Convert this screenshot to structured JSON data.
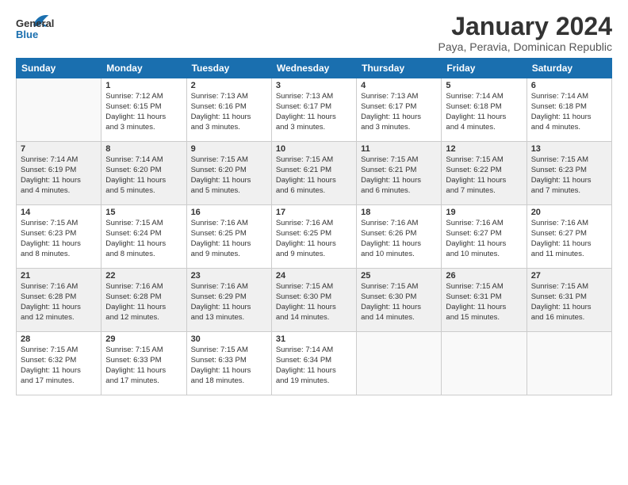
{
  "logo": {
    "general": "General",
    "blue": "Blue"
  },
  "header": {
    "title": "January 2024",
    "subtitle": "Paya, Peravia, Dominican Republic"
  },
  "weekdays": [
    "Sunday",
    "Monday",
    "Tuesday",
    "Wednesday",
    "Thursday",
    "Friday",
    "Saturday"
  ],
  "weeks": [
    [
      {
        "day": null,
        "text": ""
      },
      {
        "day": "1",
        "text": "Sunrise: 7:12 AM\nSunset: 6:15 PM\nDaylight: 11 hours\nand 3 minutes."
      },
      {
        "day": "2",
        "text": "Sunrise: 7:13 AM\nSunset: 6:16 PM\nDaylight: 11 hours\nand 3 minutes."
      },
      {
        "day": "3",
        "text": "Sunrise: 7:13 AM\nSunset: 6:17 PM\nDaylight: 11 hours\nand 3 minutes."
      },
      {
        "day": "4",
        "text": "Sunrise: 7:13 AM\nSunset: 6:17 PM\nDaylight: 11 hours\nand 3 minutes."
      },
      {
        "day": "5",
        "text": "Sunrise: 7:14 AM\nSunset: 6:18 PM\nDaylight: 11 hours\nand 4 minutes."
      },
      {
        "day": "6",
        "text": "Sunrise: 7:14 AM\nSunset: 6:18 PM\nDaylight: 11 hours\nand 4 minutes."
      }
    ],
    [
      {
        "day": "7",
        "text": "Sunrise: 7:14 AM\nSunset: 6:19 PM\nDaylight: 11 hours\nand 4 minutes."
      },
      {
        "day": "8",
        "text": "Sunrise: 7:14 AM\nSunset: 6:20 PM\nDaylight: 11 hours\nand 5 minutes."
      },
      {
        "day": "9",
        "text": "Sunrise: 7:15 AM\nSunset: 6:20 PM\nDaylight: 11 hours\nand 5 minutes."
      },
      {
        "day": "10",
        "text": "Sunrise: 7:15 AM\nSunset: 6:21 PM\nDaylight: 11 hours\nand 6 minutes."
      },
      {
        "day": "11",
        "text": "Sunrise: 7:15 AM\nSunset: 6:21 PM\nDaylight: 11 hours\nand 6 minutes."
      },
      {
        "day": "12",
        "text": "Sunrise: 7:15 AM\nSunset: 6:22 PM\nDaylight: 11 hours\nand 7 minutes."
      },
      {
        "day": "13",
        "text": "Sunrise: 7:15 AM\nSunset: 6:23 PM\nDaylight: 11 hours\nand 7 minutes."
      }
    ],
    [
      {
        "day": "14",
        "text": "Sunrise: 7:15 AM\nSunset: 6:23 PM\nDaylight: 11 hours\nand 8 minutes."
      },
      {
        "day": "15",
        "text": "Sunrise: 7:15 AM\nSunset: 6:24 PM\nDaylight: 11 hours\nand 8 minutes."
      },
      {
        "day": "16",
        "text": "Sunrise: 7:16 AM\nSunset: 6:25 PM\nDaylight: 11 hours\nand 9 minutes."
      },
      {
        "day": "17",
        "text": "Sunrise: 7:16 AM\nSunset: 6:25 PM\nDaylight: 11 hours\nand 9 minutes."
      },
      {
        "day": "18",
        "text": "Sunrise: 7:16 AM\nSunset: 6:26 PM\nDaylight: 11 hours\nand 10 minutes."
      },
      {
        "day": "19",
        "text": "Sunrise: 7:16 AM\nSunset: 6:27 PM\nDaylight: 11 hours\nand 10 minutes."
      },
      {
        "day": "20",
        "text": "Sunrise: 7:16 AM\nSunset: 6:27 PM\nDaylight: 11 hours\nand 11 minutes."
      }
    ],
    [
      {
        "day": "21",
        "text": "Sunrise: 7:16 AM\nSunset: 6:28 PM\nDaylight: 11 hours\nand 12 minutes."
      },
      {
        "day": "22",
        "text": "Sunrise: 7:16 AM\nSunset: 6:28 PM\nDaylight: 11 hours\nand 12 minutes."
      },
      {
        "day": "23",
        "text": "Sunrise: 7:16 AM\nSunset: 6:29 PM\nDaylight: 11 hours\nand 13 minutes."
      },
      {
        "day": "24",
        "text": "Sunrise: 7:15 AM\nSunset: 6:30 PM\nDaylight: 11 hours\nand 14 minutes."
      },
      {
        "day": "25",
        "text": "Sunrise: 7:15 AM\nSunset: 6:30 PM\nDaylight: 11 hours\nand 14 minutes."
      },
      {
        "day": "26",
        "text": "Sunrise: 7:15 AM\nSunset: 6:31 PM\nDaylight: 11 hours\nand 15 minutes."
      },
      {
        "day": "27",
        "text": "Sunrise: 7:15 AM\nSunset: 6:31 PM\nDaylight: 11 hours\nand 16 minutes."
      }
    ],
    [
      {
        "day": "28",
        "text": "Sunrise: 7:15 AM\nSunset: 6:32 PM\nDaylight: 11 hours\nand 17 minutes."
      },
      {
        "day": "29",
        "text": "Sunrise: 7:15 AM\nSunset: 6:33 PM\nDaylight: 11 hours\nand 17 minutes."
      },
      {
        "day": "30",
        "text": "Sunrise: 7:15 AM\nSunset: 6:33 PM\nDaylight: 11 hours\nand 18 minutes."
      },
      {
        "day": "31",
        "text": "Sunrise: 7:14 AM\nSunset: 6:34 PM\nDaylight: 11 hours\nand 19 minutes."
      },
      {
        "day": null,
        "text": ""
      },
      {
        "day": null,
        "text": ""
      },
      {
        "day": null,
        "text": ""
      }
    ]
  ]
}
